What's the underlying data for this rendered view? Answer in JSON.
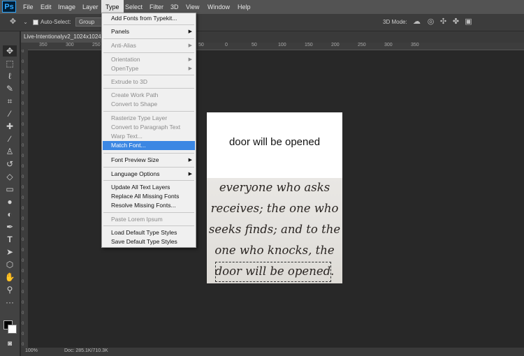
{
  "app": {
    "logo": "Ps"
  },
  "menubar": {
    "items": [
      "File",
      "Edit",
      "Image",
      "Layer",
      "Type",
      "Select",
      "Filter",
      "3D",
      "View",
      "Window",
      "Help"
    ],
    "active": "Type"
  },
  "options": {
    "auto_select_label": "Auto-Select:",
    "auto_select_value": "Group",
    "mode_3d_label": "3D Mode:"
  },
  "document": {
    "tab_title": "Live-Intentionalyv2_1024x1024...",
    "zoom": "100%",
    "doc_size": "Doc: 285.1K/710.3K",
    "match_text": "door will be opened",
    "verse_lines": [
      "everyone who asks",
      "receives; the one who",
      "seeks finds; and to the",
      "one who knocks, the",
      "door will be opened."
    ]
  },
  "ruler": {
    "top_labels": [
      "350",
      "300",
      "250",
      "200",
      "150",
      "100",
      "50",
      "0",
      "50",
      "100",
      "150",
      "200",
      "250",
      "300",
      "350"
    ]
  },
  "type_menu": {
    "items": [
      {
        "label": "Add Fonts from Typekit...",
        "state": "enabled",
        "submenu": false
      },
      {
        "label": "Panels",
        "state": "enabled",
        "submenu": true
      },
      {
        "label": "Anti-Alias",
        "state": "disabled",
        "submenu": true
      },
      {
        "label": "Orientation",
        "state": "disabled",
        "submenu": true
      },
      {
        "label": "OpenType",
        "state": "disabled",
        "submenu": true
      },
      {
        "label": "Extrude to 3D",
        "state": "disabled",
        "submenu": false
      },
      {
        "label": "Create Work Path",
        "state": "disabled",
        "submenu": false
      },
      {
        "label": "Convert to Shape",
        "state": "disabled",
        "submenu": false
      },
      {
        "label": "Rasterize Type Layer",
        "state": "disabled",
        "submenu": false
      },
      {
        "label": "Convert to Paragraph Text",
        "state": "disabled",
        "submenu": false
      },
      {
        "label": "Warp Text...",
        "state": "disabled",
        "submenu": false
      },
      {
        "label": "Match Font...",
        "state": "highlighted",
        "submenu": false
      },
      {
        "label": "Font Preview Size",
        "state": "enabled",
        "submenu": true
      },
      {
        "label": "Language Options",
        "state": "enabled",
        "submenu": true
      },
      {
        "label": "Update All Text Layers",
        "state": "enabled",
        "submenu": false
      },
      {
        "label": "Replace All Missing Fonts",
        "state": "enabled",
        "submenu": false
      },
      {
        "label": "Resolve Missing Fonts...",
        "state": "enabled",
        "submenu": false
      },
      {
        "label": "Paste Lorem Ipsum",
        "state": "disabled",
        "submenu": false
      },
      {
        "label": "Load Default Type Styles",
        "state": "enabled",
        "submenu": false
      },
      {
        "label": "Save Default Type Styles",
        "state": "enabled",
        "submenu": false
      }
    ]
  },
  "tools": [
    "move-tool",
    "marquee-tool",
    "lasso-tool",
    "quick-select-tool",
    "crop-tool",
    "eyedropper-tool",
    "healing-brush-tool",
    "brush-tool",
    "clone-stamp-tool",
    "history-brush-tool",
    "eraser-tool",
    "gradient-tool",
    "blur-tool",
    "dodge-tool",
    "pen-tool",
    "type-tool",
    "path-select-tool",
    "shape-tool",
    "hand-tool",
    "zoom-tool",
    "more-tools"
  ],
  "colors": {
    "menu_highlight": "#3b87e3",
    "workspace": "#282828",
    "panel": "#424242"
  }
}
